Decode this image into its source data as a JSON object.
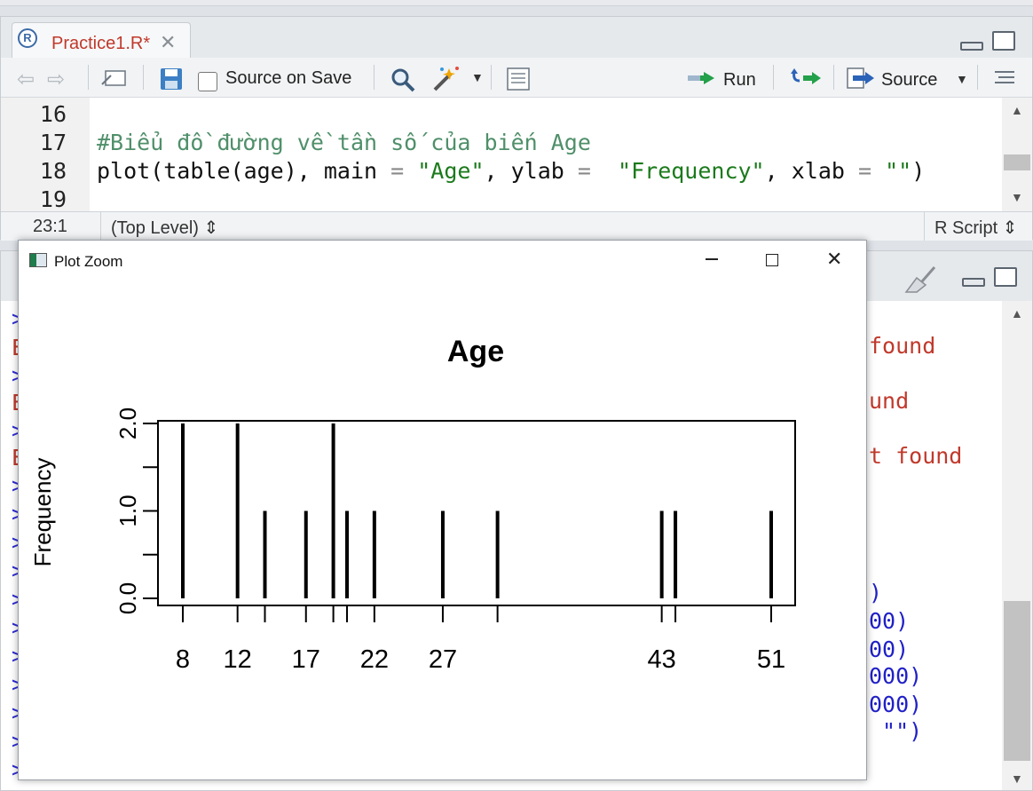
{
  "editor": {
    "tab_label": "Practice1.R*",
    "tab_icon": "R",
    "toolbar": {
      "source_on_save": "Source on Save",
      "run": "Run",
      "source": "Source"
    },
    "lines": [
      {
        "num": "16"
      },
      {
        "num": "17",
        "comment": "#Biểu đồ đường về tần số của biến Age"
      },
      {
        "num": "18",
        "p1": "plot(table(age), main ",
        "op1": "=",
        "s1": " \"Age\"",
        "p2": ", ylab ",
        "op2": "=",
        "s2": "  \"Frequency\"",
        "p3": ", xlab ",
        "op3": "=",
        "s3": " \"\"",
        "p4": ")"
      },
      {
        "num": "19"
      }
    ],
    "status": {
      "position": "23:1",
      "scope": "(Top Level) ⇕",
      "filetype": "R Script ⇕"
    }
  },
  "console": {
    "prompt_char": ">",
    "error_prefix": "E",
    "fragments": {
      "line1": "found",
      "line2": "und",
      "line3": "t found",
      "c1": ")",
      "c2": "00)",
      "c3": "00)",
      "c4": "000)",
      "c5": "000)",
      "c6": " \"\")"
    }
  },
  "plot_window": {
    "title": "Plot Zoom"
  },
  "chart_data": {
    "type": "bar",
    "title": "Age",
    "xlabel": "",
    "ylabel": "Frequency",
    "x": [
      8,
      12,
      14,
      17,
      19,
      20,
      22,
      27,
      31,
      43,
      44,
      51
    ],
    "values": [
      2,
      2,
      1,
      1,
      2,
      1,
      1,
      1,
      1,
      1,
      1,
      1
    ],
    "x_tick_labels": [
      "8",
      "12",
      "17",
      "22",
      "27",
      "43",
      "51"
    ],
    "y_ticks": [
      0,
      0.5,
      1,
      1.5,
      2
    ],
    "y_tick_labels": [
      "0.0",
      "1.0",
      "2.0"
    ],
    "ylim": [
      0,
      2
    ]
  }
}
